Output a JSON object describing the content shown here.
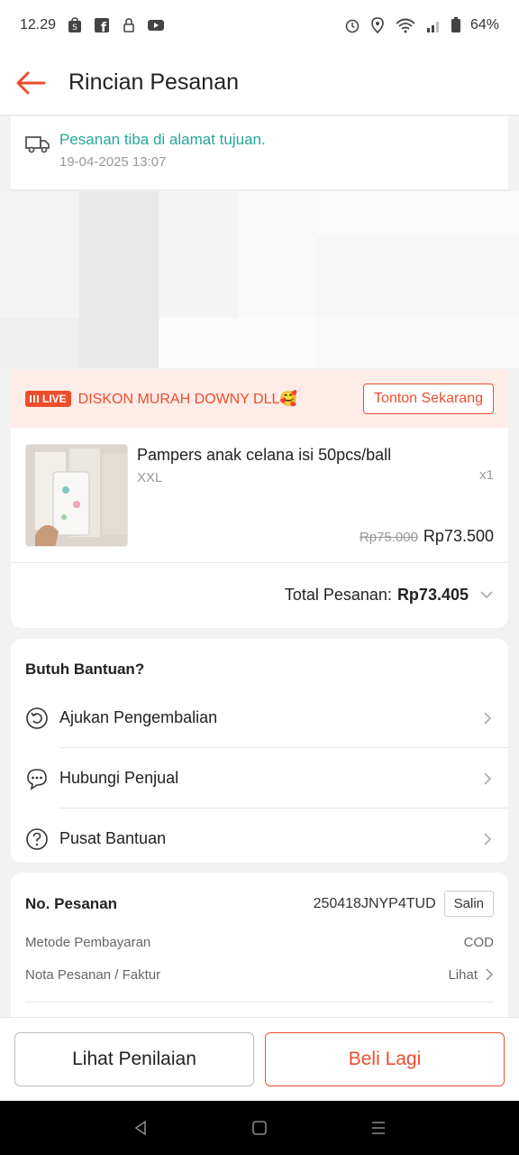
{
  "status_bar": {
    "time": "12.29",
    "battery": "64%"
  },
  "header": {
    "title": "Rincian Pesanan"
  },
  "delivery": {
    "status": "Pesanan tiba di alamat tujuan.",
    "datetime": "19-04-2025 13:07"
  },
  "live_banner": {
    "badge": "LIVE",
    "text": "DISKON MURAH DOWNY DLL🥰",
    "button": "Tonton Sekarang"
  },
  "product": {
    "name": "Pampers anak celana isi 50pcs/ball",
    "variant": "XXL",
    "quantity": "x1",
    "price_original": "Rp75.000",
    "price": "Rp73.500"
  },
  "total": {
    "label": "Total Pesanan:",
    "value": "Rp73.405"
  },
  "help": {
    "title": "Butuh Bantuan?",
    "items": [
      {
        "label": "Ajukan Pengembalian",
        "icon": "return-icon"
      },
      {
        "label": "Hubungi Penjual",
        "icon": "chat-icon"
      },
      {
        "label": "Pusat Bantuan",
        "icon": "help-icon"
      }
    ]
  },
  "order_info": {
    "order_number_label": "No. Pesanan",
    "order_number": "250418JNYP4TUD",
    "copy_button": "Salin",
    "payment_label": "Metode Pembayaran",
    "payment_value": "COD",
    "invoice_label": "Nota Pesanan / Faktur",
    "invoice_value": "Lihat"
  },
  "actions": {
    "review_button": "Lihat Penilaian",
    "buy_again_button": "Beli Lagi"
  },
  "colors": {
    "accent": "#ee4d2d",
    "success": "#26a69a"
  }
}
